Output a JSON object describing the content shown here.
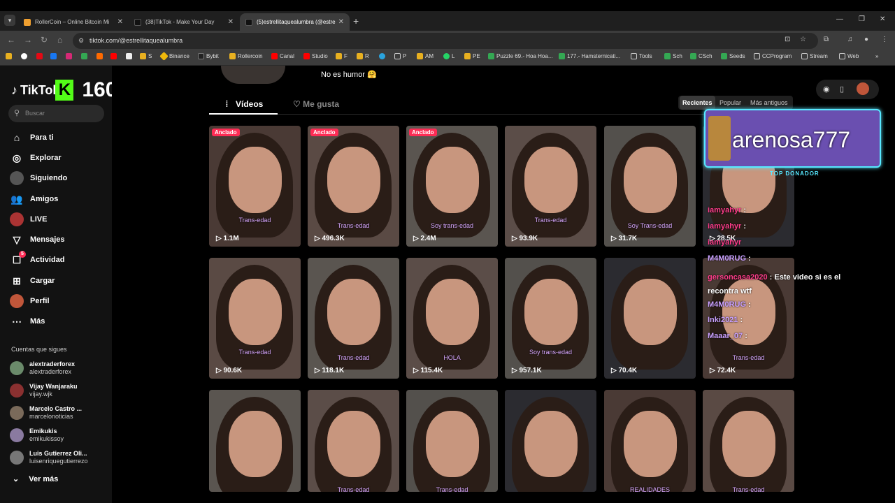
{
  "browser": {
    "tabs": [
      {
        "title": "RollerCoin – Online Bitcoin Mi",
        "active": false
      },
      {
        "title": "(38)TikTok - Make Your Day",
        "active": false
      },
      {
        "title": "(5)estrellitaquealumbra (@estre",
        "active": true
      }
    ],
    "url": "tiktok.com/@estrellitaquealumbra",
    "bookmarks": [
      "S",
      "Binance",
      "Bybit",
      "Rollercoin",
      "Canal",
      "Studio",
      "F",
      "R",
      "P",
      "AM",
      "L",
      "PE",
      "Puzzle 69.- Hoa Hoa...",
      "177.- Hamsternicati...",
      "Tools",
      "Sch",
      "CSch",
      "Seeds",
      "CCProgram",
      "Stream",
      "Web"
    ]
  },
  "sidebar": {
    "logo_text": "TikTok",
    "kick_letter": "K",
    "kick_count": "160",
    "search_placeholder": "Buscar",
    "nav": [
      {
        "label": "Para ti",
        "icon": "home-icon"
      },
      {
        "label": "Explorar",
        "icon": "compass-icon"
      },
      {
        "label": "Siguiendo",
        "icon": "avatar-icon"
      },
      {
        "label": "Amigos",
        "icon": "friends-icon"
      },
      {
        "label": "LIVE",
        "icon": "live-icon"
      },
      {
        "label": "Mensajes",
        "icon": "send-icon"
      },
      {
        "label": "Actividad",
        "icon": "activity-icon",
        "badge": "5"
      },
      {
        "label": "Cargar",
        "icon": "upload-icon"
      },
      {
        "label": "Perfil",
        "icon": "profile-icon"
      },
      {
        "label": "Más",
        "icon": "more-icon"
      }
    ],
    "following_title": "Cuentas que sigues",
    "following": [
      {
        "name": "alextraderforex",
        "user": "alextraderforex"
      },
      {
        "name": "Vijay Wanjaraku",
        "user": "vijay.wjk"
      },
      {
        "name": "Marcelo Castro ...",
        "user": "marcelonoticias"
      },
      {
        "name": "Emikukis",
        "user": "emikukissoy"
      },
      {
        "name": "Luis Gutierrez Oli...",
        "user": "luisenriquegutierrezo"
      }
    ],
    "see_more": "Ver más"
  },
  "profile": {
    "bio_line": "No es humor 🤗",
    "tabs": [
      "Vídeos",
      "Me gusta"
    ],
    "sort": [
      "Recientes",
      "Popular",
      "Más antiguos"
    ],
    "pinned_label": "Anclado",
    "videos": [
      {
        "views": "1.1M",
        "pinned": true,
        "caption": "Trans-edad"
      },
      {
        "views": "496.3K",
        "pinned": true,
        "caption": "Trans-edad"
      },
      {
        "views": "2.4M",
        "pinned": true,
        "caption": "Soy trans-edad"
      },
      {
        "views": "93.9K",
        "pinned": false,
        "caption": "Trans-edad"
      },
      {
        "views": "31.7K",
        "pinned": false,
        "caption": "Soy Trans-edad"
      },
      {
        "views": "28.5K",
        "pinned": false,
        "caption": ""
      },
      {
        "views": "90.6K",
        "pinned": false,
        "caption": "Trans-edad"
      },
      {
        "views": "118.1K",
        "pinned": false,
        "caption": "Trans-edad"
      },
      {
        "views": "115.4K",
        "pinned": false,
        "caption": "HOLA"
      },
      {
        "views": "957.1K",
        "pinned": false,
        "caption": "Soy trans-edad"
      },
      {
        "views": "70.4K",
        "pinned": false,
        "caption": ""
      },
      {
        "views": "72.4K",
        "pinned": false,
        "caption": "Trans-edad"
      },
      {
        "views": "",
        "pinned": false,
        "caption": ""
      },
      {
        "views": "",
        "pinned": false,
        "caption": "Trans-edad"
      },
      {
        "views": "",
        "pinned": false,
        "caption": "Trans-edad"
      },
      {
        "views": "",
        "pinned": false,
        "caption": ""
      },
      {
        "views": "",
        "pinned": false,
        "caption": "REALIDADES"
      },
      {
        "views": "",
        "pinned": false,
        "caption": "Trans-edad"
      }
    ]
  },
  "overlay": {
    "top_donor_name": "arenosa777",
    "top_donor_label": "TOP DONADOR",
    "chat": [
      {
        "user": "iamyahyr",
        "msg": ""
      },
      {
        "user": "iamyahyr",
        "msg": ""
      },
      {
        "user": "iamyahyr",
        "msg": ""
      },
      {
        "user": "M4M0RUG",
        "msg": ""
      },
      {
        "user": "gersoncasa2020",
        "msg": "Este video si es el recontra wtf"
      },
      {
        "user": "M4M0RUG",
        "msg": ""
      },
      {
        "user": "Inki2021",
        "msg": ""
      },
      {
        "user": "Maaar_07",
        "msg": ""
      }
    ]
  },
  "colors": {
    "accent": "#fe2c55",
    "kick": "#53fc18",
    "neon": "#57e8ff"
  }
}
